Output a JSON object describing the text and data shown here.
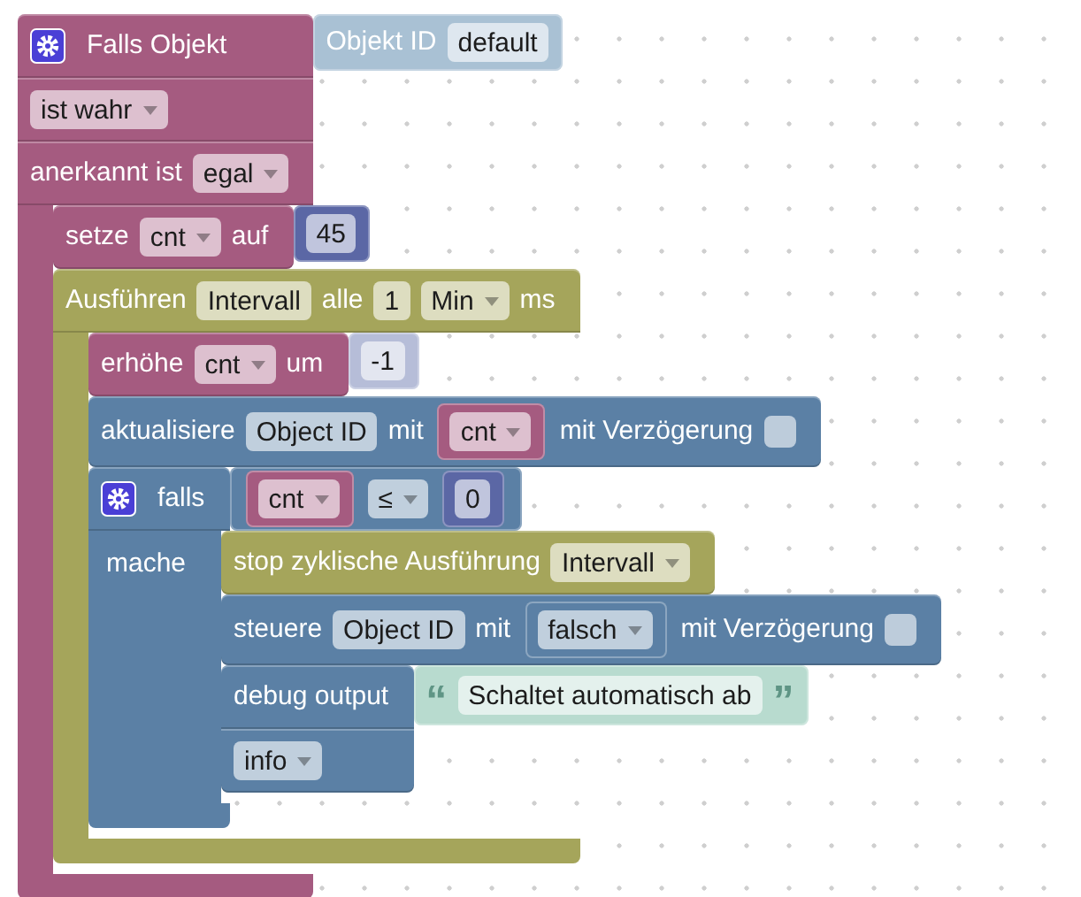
{
  "blocks": [
    {
      "kind": "statement",
      "color": "#a55b80",
      "rows": [
        [
          {
            "kind": "gear"
          },
          {
            "kind": "label",
            "text": "Falls Objekt"
          },
          {
            "kind": "external_input",
            "block": {
              "kind": "value",
              "color": "#a9c1d4",
              "rows": [
                [
                  {
                    "kind": "label",
                    "text": "Objekt ID"
                  },
                  {
                    "kind": "field",
                    "text": "default"
                  }
                ]
              ]
            }
          }
        ],
        [
          {
            "kind": "dropdown",
            "text": "ist wahr"
          }
        ],
        [
          {
            "kind": "label",
            "text": "anerkannt ist"
          },
          {
            "kind": "dropdown",
            "text": "egal"
          }
        ]
      ],
      "children": [
        {
          "kind": "statement",
          "color": "#a55b80",
          "rows": [
            [
              {
                "kind": "label",
                "text": "setze"
              },
              {
                "kind": "dropdown",
                "text": "cnt"
              },
              {
                "kind": "label",
                "text": "auf"
              },
              {
                "kind": "external_input",
                "block": {
                  "kind": "value",
                  "color": "#5b67a5",
                  "rows": [
                    [
                      {
                        "kind": "field",
                        "text": "45"
                      }
                    ]
                  ]
                }
              }
            ]
          ]
        },
        {
          "kind": "statement",
          "color": "#a5a55b",
          "rows": [
            [
              {
                "kind": "label",
                "text": "Ausführen"
              },
              {
                "kind": "field",
                "text": "Intervall"
              },
              {
                "kind": "label",
                "text": "alle"
              },
              {
                "kind": "field",
                "text": "1"
              },
              {
                "kind": "dropdown",
                "text": "Min"
              },
              {
                "kind": "label",
                "text": "ms"
              }
            ]
          ],
          "children": [
            {
              "kind": "statement",
              "color": "#a55b80",
              "rows": [
                [
                  {
                    "kind": "label",
                    "text": "erhöhe"
                  },
                  {
                    "kind": "dropdown",
                    "text": "cnt"
                  },
                  {
                    "kind": "label",
                    "text": "um"
                  },
                  {
                    "kind": "external_input",
                    "block": {
                      "kind": "value",
                      "color": "#b6bdd8",
                      "rows": [
                        [
                          {
                            "kind": "field",
                            "text": "-1"
                          }
                        ]
                      ]
                    }
                  }
                ]
              ]
            },
            {
              "kind": "statement",
              "color": "#5b80a5",
              "rows": [
                [
                  {
                    "kind": "label",
                    "text": "aktualisiere"
                  },
                  {
                    "kind": "field",
                    "text": "Object ID"
                  },
                  {
                    "kind": "label",
                    "text": "mit"
                  },
                  {
                    "kind": "inline_input",
                    "block": {
                      "kind": "value",
                      "color": "#a55b80",
                      "rows": [
                        [
                          {
                            "kind": "dropdown",
                            "text": "cnt"
                          }
                        ]
                      ]
                    }
                  },
                  {
                    "kind": "label",
                    "text": "mit Verzögerung"
                  },
                  {
                    "kind": "checkbox",
                    "checked": false
                  }
                ]
              ]
            },
            {
              "kind": "statement",
              "color": "#5b80a5",
              "arm_label": "mache",
              "rows": [
                [
                  {
                    "kind": "gear"
                  },
                  {
                    "kind": "label",
                    "text": "falls"
                  },
                  {
                    "kind": "external_input",
                    "block": {
                      "kind": "value",
                      "color": "#5b80a5",
                      "rows": [
                        [
                          {
                            "kind": "inline_input",
                            "block": {
                              "kind": "value",
                              "color": "#a55b80",
                              "rows": [
                                [
                                  {
                                    "kind": "dropdown",
                                    "text": "cnt"
                                  }
                                ]
                              ]
                            }
                          },
                          {
                            "kind": "dropdown",
                            "text": "≤"
                          },
                          {
                            "kind": "inline_input",
                            "block": {
                              "kind": "value",
                              "color": "#5b67a5",
                              "rows": [
                                [
                                  {
                                    "kind": "field",
                                    "text": "0"
                                  }
                                ]
                              ]
                            }
                          }
                        ]
                      ]
                    }
                  }
                ]
              ],
              "children": [
                {
                  "kind": "statement",
                  "color": "#a5a55b",
                  "rows": [
                    [
                      {
                        "kind": "label",
                        "text": "stop zyklische Ausführung"
                      },
                      {
                        "kind": "dropdown",
                        "text": "Intervall"
                      }
                    ]
                  ]
                },
                {
                  "kind": "statement",
                  "color": "#5b80a5",
                  "rows": [
                    [
                      {
                        "kind": "label",
                        "text": "steuere"
                      },
                      {
                        "kind": "field",
                        "text": "Object ID"
                      },
                      {
                        "kind": "label",
                        "text": "mit"
                      },
                      {
                        "kind": "inline_input",
                        "block": {
                          "kind": "value",
                          "color": "#5b80a5",
                          "rows": [
                            [
                              {
                                "kind": "dropdown",
                                "text": "falsch"
                              }
                            ]
                          ]
                        }
                      },
                      {
                        "kind": "label",
                        "text": "mit Verzögerung"
                      },
                      {
                        "kind": "checkbox",
                        "checked": false
                      }
                    ]
                  ]
                },
                {
                  "kind": "statement",
                  "color": "#5b80a5",
                  "rows": [
                    [
                      {
                        "kind": "label",
                        "text": "debug output"
                      },
                      {
                        "kind": "external_input",
                        "block": {
                          "kind": "value",
                          "color": "#b8dbcf",
                          "rows": [
                            [
                              {
                                "kind": "quote",
                                "text": "“"
                              },
                              {
                                "kind": "field",
                                "text": "Schaltet automatisch ab"
                              },
                              {
                                "kind": "quote",
                                "text": "”"
                              }
                            ]
                          ]
                        }
                      }
                    ],
                    [
                      {
                        "kind": "dropdown",
                        "text": "info"
                      }
                    ]
                  ]
                }
              ]
            }
          ]
        }
      ]
    }
  ]
}
